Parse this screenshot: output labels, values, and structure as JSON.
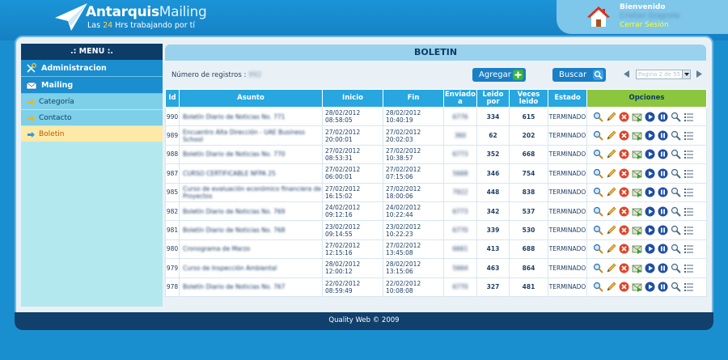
{
  "app": {
    "logo_brand": "Antarquis",
    "logo_product": "Mailing",
    "tagline_prefix": "Las ",
    "tagline_highlight": "24",
    "tagline_suffix": " Hrs trabajando por tí"
  },
  "user": {
    "welcome": "Bienvenido",
    "name": "Cristian Gragnola",
    "logout": "Cerrar Sesión"
  },
  "menu": {
    "title": ".: MENU :.",
    "sections": [
      {
        "label": "Administracion",
        "icon": "tools-icon"
      },
      {
        "label": "Mailing",
        "icon": "mail-icon"
      }
    ],
    "items": [
      {
        "label": "Categoría",
        "active": false
      },
      {
        "label": "Contacto",
        "active": false
      },
      {
        "label": "Boletin",
        "active": true
      }
    ]
  },
  "page": {
    "title": "BOLETIN",
    "records_label": "Número de registros :",
    "records_value": "992",
    "add_button": "Agregar",
    "search_button": "Buscar",
    "pager_text": "Pagina 2 de 55"
  },
  "table": {
    "headers": [
      "Id",
      "Asunto",
      "Inicio",
      "Fin",
      "Enviado a",
      "Leido por",
      "Veces leido",
      "Estado",
      "Opciones"
    ],
    "rows": [
      {
        "id": "990",
        "asunto": "Boletín Diario de Noticias No. 771",
        "inicio_date": "28/02/2012",
        "inicio_time": "08:58:05",
        "fin_date": "28/02/2012",
        "fin_time": "10:40:19",
        "enviado": "6776",
        "leido": "334",
        "veces": "615",
        "estado": "TERMINADO"
      },
      {
        "id": "989",
        "asunto": "Encuentro Alta Dirección - UAE Business School",
        "inicio_date": "27/02/2012",
        "inicio_time": "20:00:01",
        "fin_date": "27/02/2012",
        "fin_time": "20:02:03",
        "enviado": "360",
        "leido": "62",
        "veces": "202",
        "estado": "TERMINADO"
      },
      {
        "id": "988",
        "asunto": "Boletín Diario de Noticias No. 770",
        "inicio_date": "27/02/2012",
        "inicio_time": "08:53:31",
        "fin_date": "27/02/2012",
        "fin_time": "10:38:57",
        "enviado": "6773",
        "leido": "352",
        "veces": "668",
        "estado": "TERMINADO"
      },
      {
        "id": "987",
        "asunto": "CURSO CERTIFICABLE NFPA 25",
        "inicio_date": "27/02/2012",
        "inicio_time": "06:00:01",
        "fin_date": "27/02/2012",
        "fin_time": "07:15:06",
        "enviado": "5668",
        "leido": "346",
        "veces": "754",
        "estado": "TERMINADO"
      },
      {
        "id": "985",
        "asunto": "Curso de evaluación económico financiera de Proyectos",
        "inicio_date": "27/02/2012",
        "inicio_time": "16:15:02",
        "fin_date": "27/02/2012",
        "fin_time": "18:00:06",
        "enviado": "7922",
        "leido": "448",
        "veces": "838",
        "estado": "TERMINADO"
      },
      {
        "id": "982",
        "asunto": "Boletín Diario de Noticias No. 769",
        "inicio_date": "24/02/2012",
        "inicio_time": "09:12:16",
        "fin_date": "24/02/2012",
        "fin_time": "10:22:44",
        "enviado": "6773",
        "leido": "342",
        "veces": "537",
        "estado": "TERMINADO"
      },
      {
        "id": "981",
        "asunto": "Boletín Diario de Noticias No. 768",
        "inicio_date": "23/02/2012",
        "inicio_time": "09:14:55",
        "fin_date": "23/02/2012",
        "fin_time": "10:22:23",
        "enviado": "6770",
        "leido": "339",
        "veces": "530",
        "estado": "TERMINADO"
      },
      {
        "id": "980",
        "asunto": "Cronograma de Marzo",
        "inicio_date": "27/02/2012",
        "inicio_time": "12:15:16",
        "fin_date": "27/02/2012",
        "fin_time": "13:45:08",
        "enviado": "6661",
        "leido": "413",
        "veces": "688",
        "estado": "TERMINADO"
      },
      {
        "id": "979",
        "asunto": "Curso de Inspección Ambiental",
        "inicio_date": "28/02/2012",
        "inicio_time": "12:00:12",
        "fin_date": "28/02/2012",
        "fin_time": "13:15:06",
        "enviado": "5664",
        "leido": "463",
        "veces": "864",
        "estado": "TERMINADO"
      },
      {
        "id": "978",
        "asunto": "Boletín Diario de Noticias No. 767",
        "inicio_date": "22/02/2012",
        "inicio_time": "08:59:49",
        "fin_date": "22/02/2012",
        "fin_time": "10:08:08",
        "enviado": "6770",
        "leido": "327",
        "veces": "481",
        "estado": "TERMINADO"
      }
    ],
    "row_actions": [
      "view-icon",
      "edit-icon",
      "delete-icon",
      "send-icon",
      "play-icon",
      "pause-icon",
      "search-icon",
      "list-icon"
    ]
  },
  "footer": {
    "text": "Quality Web © 2009"
  },
  "colors": {
    "background": "#1a8fd0",
    "nav_dark": "#0d3c66",
    "header_cell": "#27a6e0",
    "options_header": "#8cc63e",
    "active_item": "#ffe9a6"
  }
}
